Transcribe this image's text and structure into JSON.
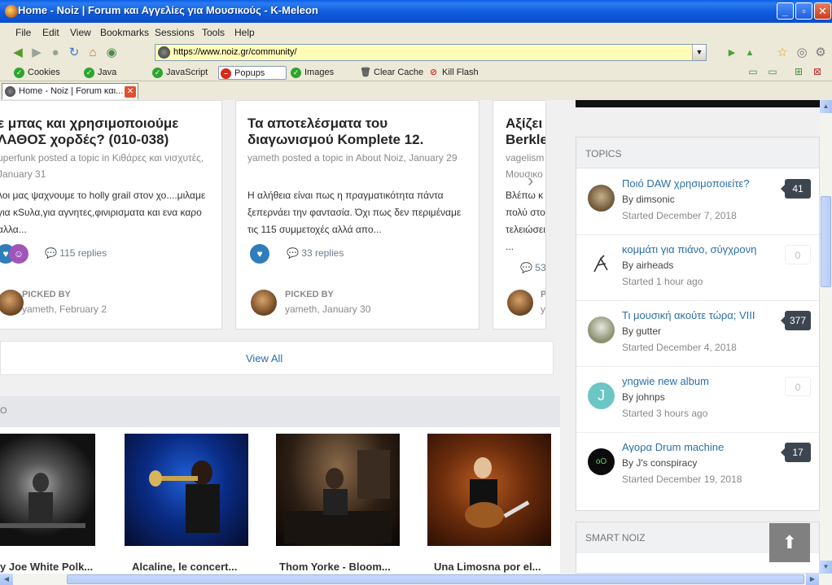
{
  "window": {
    "title": "Home - Noiz | Forum και Αγγελίες για Μουσικούς - K-Meleon",
    "minimize": "_",
    "maximize": "▫",
    "close": "✕"
  },
  "menu": [
    "File",
    "Edit",
    "View",
    "Bookmarks",
    "Sessions",
    "Tools",
    "Help"
  ],
  "address": {
    "url": "https://www.noiz.gr/community/"
  },
  "toggles": {
    "cookies": "Cookies",
    "java": "Java",
    "javascript": "JavaScript",
    "popups": "Popups",
    "images": "Images",
    "clear_cache": "Clear Cache",
    "kill_flash": "Kill Flash"
  },
  "tab": {
    "label": "Home - Noiz | Forum και..."
  },
  "featured": [
    {
      "title": "ε μπας και χρησιμοποιούμε ΛΑΘΟΣ χορδές? (010-038)",
      "meta": "uperfunk posted a topic in Κιθάρες και νισχυτές, January 31",
      "excerpt": "λοι μας ψαχνουμε το holly grail στον χο....μιλαμε για κSυλα,για αγνητες,φινιρισματα και ενα καρο αλλα...",
      "replies": "115 replies",
      "picked_label": "PICKED BY",
      "picked_by": "yameth, February 2"
    },
    {
      "title": "Τα αποτελέσματα του διαγωνισμού Komplete 12.",
      "meta": "yameth posted a topic in About Noiz, January 29",
      "excerpt": "Η αλήθεια είναι πως η πραγματικότητα πάντα ξεπερνάει την φαντασία. Όχι πως δεν περιμέναμε τις 115 συμμετοχές αλλά απο...",
      "replies": "33 replies",
      "picked_label": "PICKED BY",
      "picked_by": "yameth, January 30"
    },
    {
      "title": "Αξίζει Berkle",
      "meta": "vagelism Μουσικο",
      "excerpt": "Βλέπω κ πολύ στο τελειώσει ...",
      "replies": "53",
      "picked_label": "P",
      "picked_by": "y"
    }
  ],
  "view_all": "View All",
  "videos_header": "O",
  "videos": [
    {
      "label": "y Joe White Polk..."
    },
    {
      "label": "Alcaline, le concert..."
    },
    {
      "label": "Thom Yorke - Bloom..."
    },
    {
      "label": "Una Limosna por el..."
    }
  ],
  "topics": {
    "header": "TOPICS",
    "items": [
      {
        "title": "Ποιό DAW χρησιμοποιείτε?",
        "by": "By dimsonic",
        "started": "Started December 7, 2018",
        "count": "41"
      },
      {
        "title": "κομμάτι για πιάνο, σύγχρονη",
        "by": "By airheads",
        "started": "Started 1 hour ago",
        "count": "0"
      },
      {
        "title": "Τι μουσική ακούτε τώρα; VIII",
        "by": "By gutter",
        "started": "Started December 4, 2018",
        "count": "377"
      },
      {
        "title": "yngwie new album",
        "by": "By johnps",
        "started": "Started 3 hours ago",
        "count": "0",
        "avatar_letter": "J"
      },
      {
        "title": "Αγορα Drum machine",
        "by": "By J's conspiracy",
        "started": "Started December 19, 2018",
        "count": "17",
        "avatar_letter": "oO"
      }
    ]
  },
  "smart": {
    "header": "SMART NOIZ"
  },
  "colors": {
    "link": "#2a6fa8",
    "badge": "#3d4650",
    "heart": "#2f7dbb",
    "url_bg": "#fffbb8"
  }
}
